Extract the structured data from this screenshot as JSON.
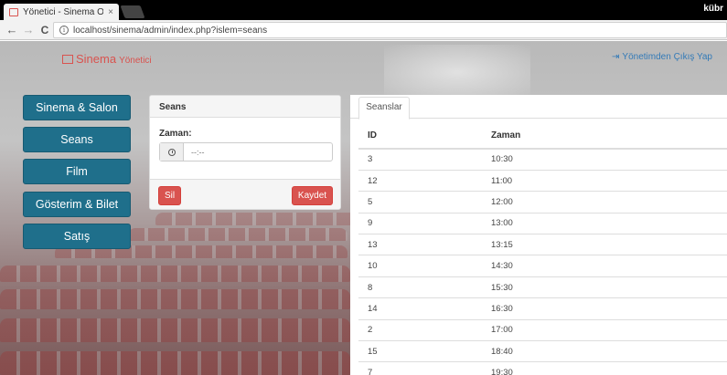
{
  "browser": {
    "tab_title": "Yönetici - Sinema Otoma",
    "tab_close": "×",
    "user_label": "kübr",
    "back": "←",
    "forward": "→",
    "reload": "C",
    "info": "i",
    "url": "localhost/sinema/admin/index.php?islem=seans"
  },
  "header": {
    "brand_name": "Sinema",
    "brand_sub": "Yönetici",
    "logout_icon": "⇥",
    "logout_label": "Yönetimden Çıkış Yap"
  },
  "menu": [
    {
      "label": "Sinema & Salon"
    },
    {
      "label": "Seans"
    },
    {
      "label": "Film"
    },
    {
      "label": "Gösterim & Bilet"
    },
    {
      "label": "Satış"
    }
  ],
  "form": {
    "title": "Seans",
    "time_label": "Zaman:",
    "time_placeholder": "--:--",
    "delete_label": "Sil",
    "save_label": "Kaydet"
  },
  "table": {
    "tab_label": "Seanslar",
    "headers": [
      "ID",
      "Zaman"
    ],
    "rows": [
      [
        "3",
        "10:30"
      ],
      [
        "12",
        "11:00"
      ],
      [
        "5",
        "12:00"
      ],
      [
        "9",
        "13:00"
      ],
      [
        "13",
        "13:15"
      ],
      [
        "10",
        "14:30"
      ],
      [
        "8",
        "15:30"
      ],
      [
        "14",
        "16:30"
      ],
      [
        "2",
        "17:00"
      ],
      [
        "15",
        "18:40"
      ],
      [
        "7",
        "19:30"
      ]
    ]
  },
  "colors": {
    "brand": "#d9534f",
    "menu": "#1f6f8b",
    "link": "#337ab7"
  }
}
